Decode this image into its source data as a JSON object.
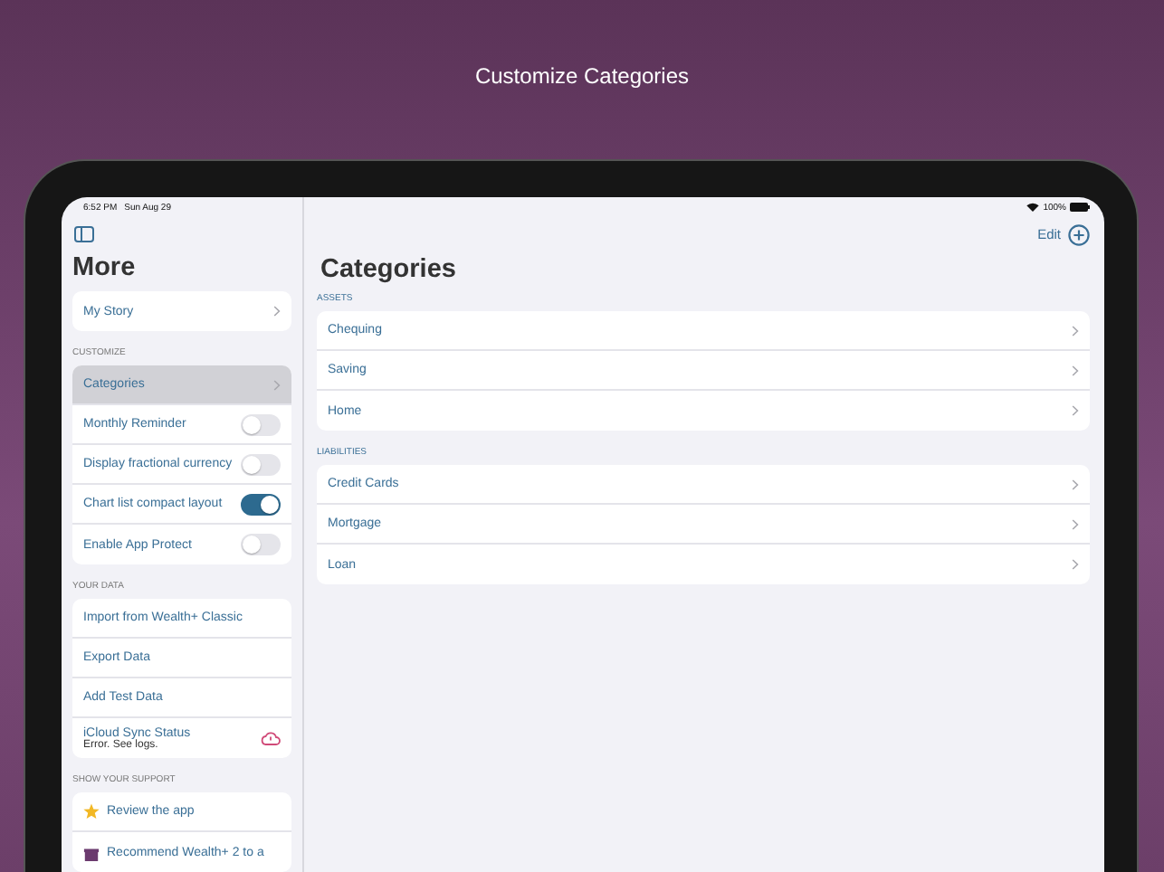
{
  "header": {
    "title": "Customize Categories"
  },
  "status_bar": {
    "time": "6:52 PM",
    "date": "Sun Aug 29",
    "battery": "100%"
  },
  "sidebar": {
    "title": "More",
    "sections": [
      {
        "items": [
          {
            "kind": "link",
            "label": "My Story",
            "selected": false
          }
        ]
      },
      {
        "heading": "CUSTOMIZE",
        "items": [
          {
            "kind": "link",
            "label": "Categories",
            "selected": true
          },
          {
            "kind": "toggle",
            "label": "Monthly Reminder",
            "on": false
          },
          {
            "kind": "toggle",
            "label": "Display fractional currency",
            "on": false
          },
          {
            "kind": "toggle",
            "label": "Chart list compact layout",
            "on": true
          },
          {
            "kind": "toggle",
            "label": "Enable App Protect",
            "on": false
          }
        ]
      },
      {
        "heading": "YOUR DATA",
        "items": [
          {
            "kind": "action",
            "label": "Import from Wealth+ Classic"
          },
          {
            "kind": "action",
            "label": "Export Data"
          },
          {
            "kind": "action",
            "label": "Add Test Data"
          },
          {
            "kind": "status",
            "label": "iCloud Sync Status",
            "detail": "Error. See logs."
          }
        ]
      },
      {
        "heading": "SHOW YOUR SUPPORT",
        "items": [
          {
            "kind": "star",
            "label": "Review the app"
          },
          {
            "kind": "gift",
            "label": "Recommend Wealth+ 2 to a"
          }
        ]
      }
    ]
  },
  "detail": {
    "edit_label": "Edit",
    "title": "Categories",
    "groups": [
      {
        "heading": "ASSETS",
        "items": [
          "Chequing",
          "Saving",
          "Home"
        ]
      },
      {
        "heading": "LIABILITIES",
        "items": [
          "Credit Cards",
          "Mortgage",
          "Loan"
        ]
      }
    ]
  }
}
